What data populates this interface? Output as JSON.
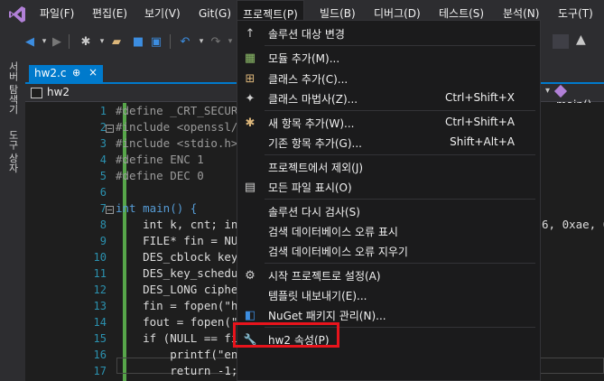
{
  "menubar": {
    "items": [
      "파일(F)",
      "편집(E)",
      "보기(V)",
      "Git(G)",
      "프로젝트(P)",
      "빌드(B)",
      "디버그(D)",
      "테스트(S)",
      "분석(N)",
      "도구(T)"
    ]
  },
  "toolbar": {
    "right_label": "거"
  },
  "side_tabs": [
    "서버 탐색기",
    "도구 상자"
  ],
  "tabs": {
    "active": "hw2.c",
    "pin": "⊕",
    "close": "×"
  },
  "navbar": {
    "project": "hw2",
    "function": "main()"
  },
  "editor": {
    "line_numbers": [
      "1",
      "2",
      "3",
      "4",
      "5",
      "6",
      "7",
      "8",
      "9",
      "10",
      "11",
      "12",
      "13",
      "14",
      "15",
      "16",
      "17",
      "18"
    ],
    "lines": [
      "#define _CRT_SECURE",
      "#include <openssl/",
      "#include <stdio.h>",
      "#define ENC 1",
      "#define DEC 0",
      "",
      "int main() {",
      "    int k, cnt; int",
      "    FILE* fin = NUL",
      "    DES_cblock key",
      "    DES_key_schedu",
      "    DES_LONG cipher",
      "    fin = fopen(\"h",
      "    fout = fopen(\"",
      "    if (NULL == fin",
      "        printf(\"ent",
      "        return -1;",
      "    }"
    ],
    "overflow_text": "6, 0xae, 0x"
  },
  "menu": {
    "items": [
      {
        "icon": "up-arrow-icon",
        "glyph": "↑",
        "label": "솔루션 대상 변경",
        "shortcut": ""
      },
      {
        "icon": "add-module-icon",
        "glyph": "▦",
        "label": "모듈 추가(M)...",
        "shortcut": ""
      },
      {
        "icon": "add-class-icon",
        "glyph": "⊞",
        "label": "클래스 추가(C)...",
        "shortcut": ""
      },
      {
        "icon": "class-wizard-icon",
        "glyph": "✦",
        "label": "클래스 마법사(Z)...",
        "shortcut": "Ctrl+Shift+X"
      },
      {
        "icon": "new-item-icon",
        "glyph": "✱",
        "label": "새 항목 추가(W)...",
        "shortcut": "Ctrl+Shift+A"
      },
      {
        "icon": "existing-item-icon",
        "glyph": "",
        "label": "기존 항목 추가(G)...",
        "shortcut": "Shift+Alt+A"
      },
      {
        "icon": "exclude-icon",
        "glyph": "",
        "label": "프로젝트에서 제외(J)",
        "shortcut": ""
      },
      {
        "icon": "show-all-files-icon",
        "glyph": "▤",
        "label": "모든 파일 표시(O)",
        "shortcut": ""
      },
      {
        "icon": "rescan-icon",
        "glyph": "",
        "label": "솔루션 다시 검사(S)",
        "shortcut": ""
      },
      {
        "icon": "db-errors-icon",
        "glyph": "",
        "label": "검색 데이터베이스 오류 표시",
        "shortcut": ""
      },
      {
        "icon": "db-clear-icon",
        "glyph": "",
        "label": "검색 데이터베이스 오류 지우기",
        "shortcut": ""
      },
      {
        "icon": "startup-gear-icon",
        "glyph": "⚙",
        "label": "시작 프로젝트로 설정(A)",
        "shortcut": ""
      },
      {
        "icon": "export-template-icon",
        "glyph": "",
        "label": "템플릿 내보내기(E)...",
        "shortcut": ""
      },
      {
        "icon": "nuget-icon",
        "glyph": "◧",
        "label": "NuGet 패키지 관리(N)...",
        "shortcut": ""
      },
      {
        "icon": "wrench-icon",
        "glyph": "🔧",
        "label": "hw2 속성(P)",
        "shortcut": ""
      }
    ]
  },
  "colors": {
    "accent": "#007acc",
    "highlight_border": "#e8141c",
    "menu_bg": "#1b1b1c"
  }
}
